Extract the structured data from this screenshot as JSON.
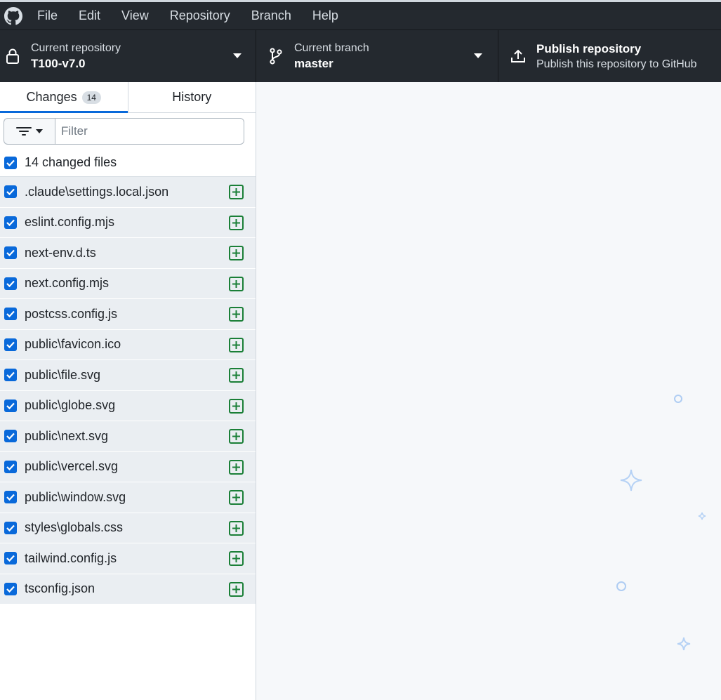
{
  "menu": {
    "items": [
      "File",
      "Edit",
      "View",
      "Repository",
      "Branch",
      "Help"
    ]
  },
  "toolbar": {
    "repository": {
      "label": "Current repository",
      "value": "T100-v7.0"
    },
    "branch": {
      "label": "Current branch",
      "value": "master"
    },
    "publish": {
      "title": "Publish repository",
      "subtitle": "Publish this repository to GitHub"
    }
  },
  "sidebar": {
    "tabs": {
      "changes": {
        "label": "Changes",
        "count": "14"
      },
      "history": {
        "label": "History"
      }
    },
    "filter": {
      "placeholder": "Filter"
    },
    "select_all_label": "14 changed files",
    "files": [
      ".claude\\settings.local.json",
      "eslint.config.mjs",
      "next-env.d.ts",
      "next.config.mjs",
      "postcss.config.js",
      "public\\favicon.ico",
      "public\\file.svg",
      "public\\globe.svg",
      "public\\next.svg",
      "public\\vercel.svg",
      "public\\window.svg",
      "styles\\globals.css",
      "tailwind.config.js",
      "tsconfig.json"
    ]
  },
  "icons": {
    "logo": "github-logo-icon",
    "lock": "lock-icon",
    "branch": "git-branch-icon",
    "upload": "upload-icon",
    "filter": "filter-icon",
    "added": "diff-added-icon"
  },
  "colors": {
    "toolbar_bg": "#24292f",
    "accent": "#0969da",
    "added_green": "#1a7f37",
    "row_bg": "#eaeef2"
  }
}
